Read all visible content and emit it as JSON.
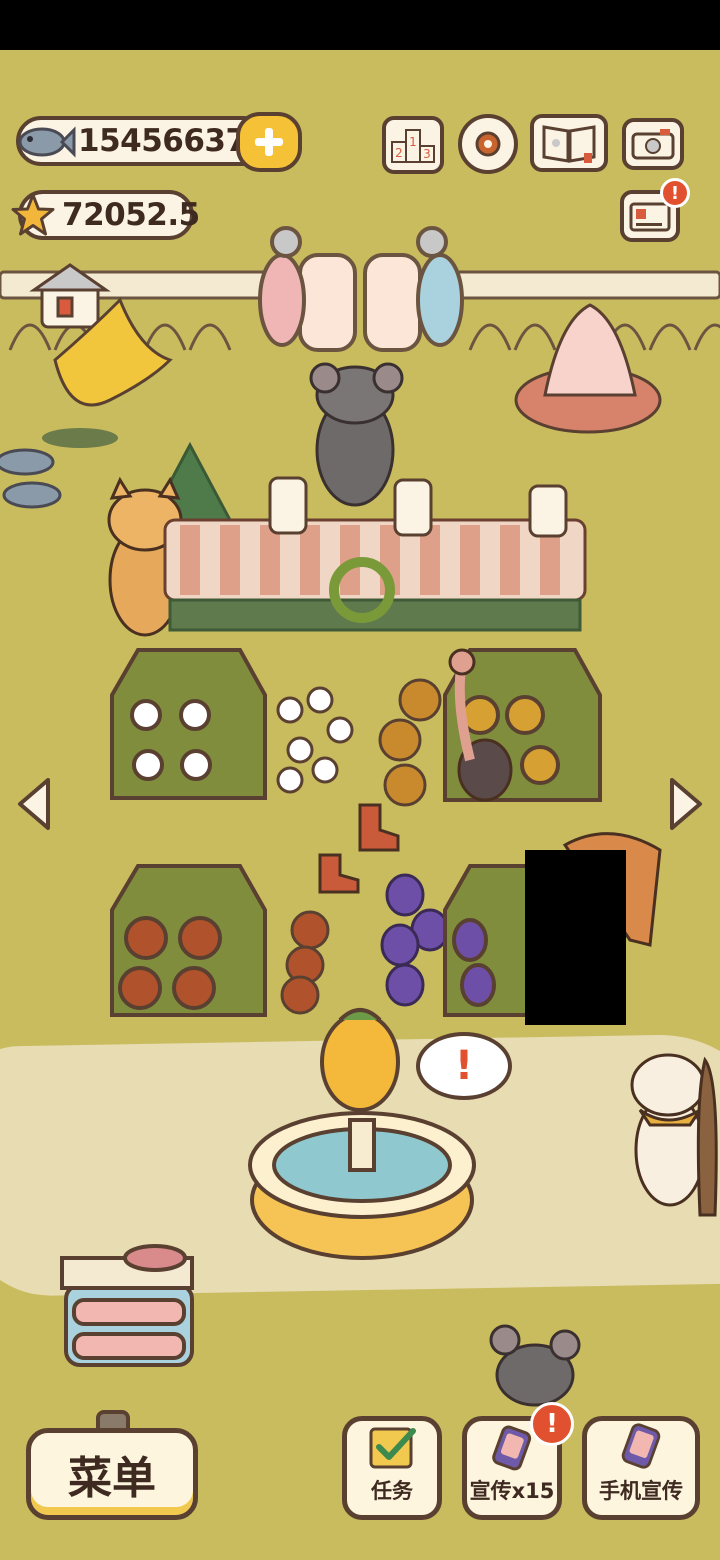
{
  "currencies": {
    "fish_coins": "15456637",
    "stars": "72052.5"
  },
  "buttons": {
    "menu_label": "菜单",
    "task_label": "任务",
    "promote_label": "宣传x15",
    "phone_promote_label": "手机宣传"
  },
  "alerts": {
    "mail_badge": "!",
    "promote_badge": "!",
    "speech_bubble": "!"
  },
  "icons": {
    "top_bar": [
      "ranking-icon",
      "settings-gear-icon",
      "album-book-icon",
      "camera-icon"
    ],
    "mail": "mail-icon",
    "nav": [
      "left-arrow-icon",
      "right-arrow-icon"
    ]
  },
  "colors": {
    "ground": "#c9bc5f",
    "path": "#e8dcb2",
    "outline": "#5a4030",
    "accent_yellow": "#f5c237",
    "alert_red": "#e2512f"
  }
}
